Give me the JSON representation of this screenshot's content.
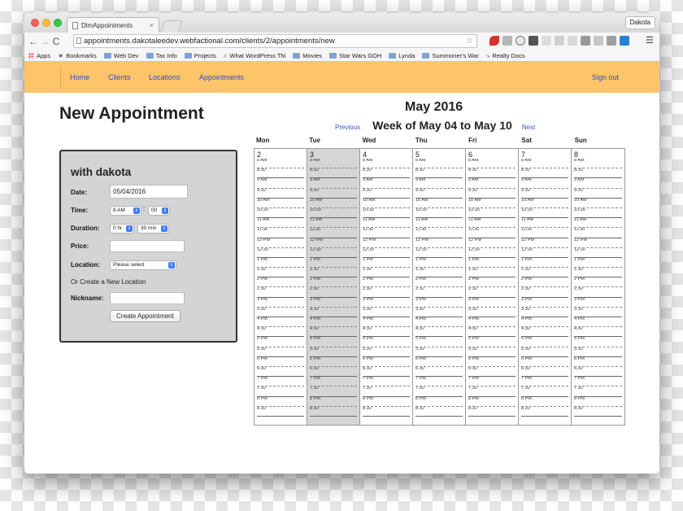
{
  "browser": {
    "tab_title": "DlmAppointments",
    "tab_close": "×",
    "profile": "Dakota",
    "url": "appointments.dakotaleedev.webfactional.com/clients/2/appointments/new",
    "nav_back": "←",
    "nav_forward": "→",
    "nav_reload": "C",
    "bookmarks": [
      {
        "label": "Apps",
        "icon": "apps-icon"
      },
      {
        "label": "Bookmarks",
        "icon": "star-icon"
      },
      {
        "label": "Web Dev",
        "icon": "folder-icon"
      },
      {
        "label": "Tax Info",
        "icon": "folder-icon"
      },
      {
        "label": "Projects",
        "icon": "folder-icon"
      },
      {
        "label": "What WordPress Thi",
        "icon": "search-icon"
      },
      {
        "label": "Movies",
        "icon": "folder-icon"
      },
      {
        "label": "Star Wars GOH",
        "icon": "folder-icon"
      },
      {
        "label": "Lynda",
        "icon": "folder-icon"
      },
      {
        "label": "Summoner's War",
        "icon": "folder-icon"
      },
      {
        "label": "Realty Docs",
        "icon": "link-icon"
      }
    ]
  },
  "nav": {
    "home": "Home",
    "clients": "Clients",
    "locations": "Locations",
    "appointments": "Appointments",
    "signout": "Sign out"
  },
  "page_title": "New Appointment",
  "form": {
    "heading": "with dakota",
    "date_label": "Date:",
    "date_value": "05/04/2016",
    "time_label": "Time:",
    "time_hour": "8 AM",
    "time_colon": ":",
    "time_minute": "00",
    "duration_label": "Duration:",
    "duration_hr": "0 hr",
    "duration_min": "30 min",
    "price_label": "Price:",
    "price_value": "",
    "location_label": "Location:",
    "location_value": "Please select",
    "or_create": "Or Create a New Location",
    "nickname_label": "Nickname:",
    "nickname_value": "",
    "submit": "Create Appointment"
  },
  "calendar": {
    "month": "May 2016",
    "prev": "Previous",
    "week_label": "Week of May 04 to May 10",
    "next": "Next",
    "selected_day": "3",
    "days": [
      {
        "name": "Mon",
        "num": "2"
      },
      {
        "name": "Tue",
        "num": "3"
      },
      {
        "name": "Wed",
        "num": "4"
      },
      {
        "name": "Thu",
        "num": "5"
      },
      {
        "name": "Fri",
        "num": "6"
      },
      {
        "name": "Sat",
        "num": "7"
      },
      {
        "name": "Sun",
        "num": "8"
      }
    ],
    "slots": [
      "8 AM",
      "8:30",
      "9 AM",
      "9:30",
      "10 AM",
      "10:30",
      "11 AM",
      "11:30",
      "12 PM",
      "12:30",
      "1 PM",
      "1:30",
      "2 PM",
      "2:30",
      "3 PM",
      "3:30",
      "4 PM",
      "4:30",
      "5 PM",
      "5:30",
      "6 PM",
      "6:30",
      "7 PM",
      "7:30",
      "8 PM",
      "8:30"
    ]
  },
  "colors": {
    "nav_bar": "#fdc46a",
    "link": "#2d4bd8",
    "selected_day": "#d6d6d6"
  }
}
